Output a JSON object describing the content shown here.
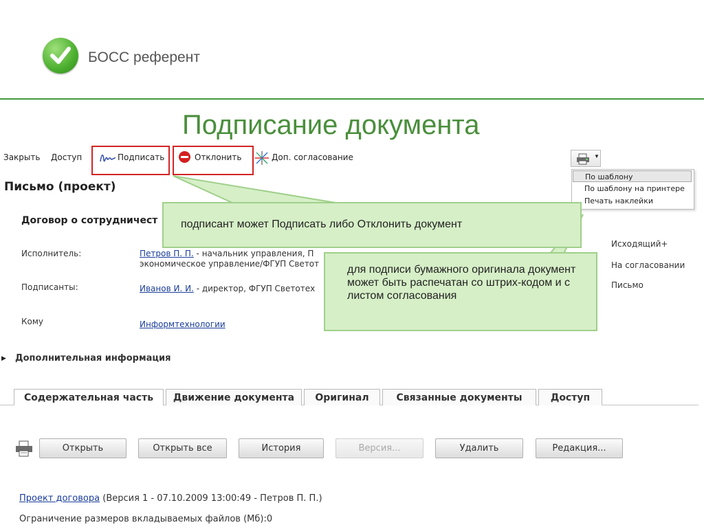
{
  "logo": {
    "name": "БОСС референт"
  },
  "slide_title": "Подписание документа",
  "toolbar": {
    "close": "Закрыть",
    "access": "Доступ",
    "sign": "Подписать",
    "reject": "Отклонить",
    "extra_approval": "Доп. согласование"
  },
  "print_menu": {
    "items": [
      "По шаблону",
      "По шаблону на принтере",
      "Печать наклейки"
    ]
  },
  "document": {
    "title": "Письмо (проект)",
    "subject": "Договор о сотрудничест",
    "executor_label": "Исполнитель:",
    "executor_link": "Петров П. П.",
    "executor_rest_1": " - начальник управления, П",
    "executor_rest_2": "экономическое управление/ФГУП Светот",
    "signers_label": "Подписанты:",
    "signers_link": "Иванов И. И.",
    "signers_rest": " - директор, ФГУП Светотех",
    "to_label": "Кому",
    "to_link": "Информтехнологии",
    "right_meta": [
      "Исходящий+",
      "На согласовании",
      "Письмо"
    ],
    "additional_info": "Дополнительная информация"
  },
  "callouts": {
    "first": "подписант может Подписать либо Отклонить документ",
    "second": "для подписи бумажного оригинала документ может быть распечатан со штрих-кодом и с листом согласования"
  },
  "tabs": [
    "Содержательная часть",
    "Движение документа",
    "Оригинал",
    "Связанные документы",
    "Доступ"
  ],
  "buttons": {
    "open": "Открыть",
    "open_all": "Открыть все",
    "history": "История",
    "version": "Версия...",
    "delete": "Удалить",
    "edit": "Редакция..."
  },
  "attachment": {
    "link": "Проект договора",
    "info": " (Версия 1 - 07.10.2009 13:00:49 - Петров П. П.)",
    "limit": "Ограничение размеров вкладываемых файлов (Мб):0"
  },
  "colors": {
    "accent_green": "#4a8f3c",
    "callout_bg": "#d6efc7",
    "highlight_red": "#d32424",
    "link": "#1a3d9a"
  }
}
